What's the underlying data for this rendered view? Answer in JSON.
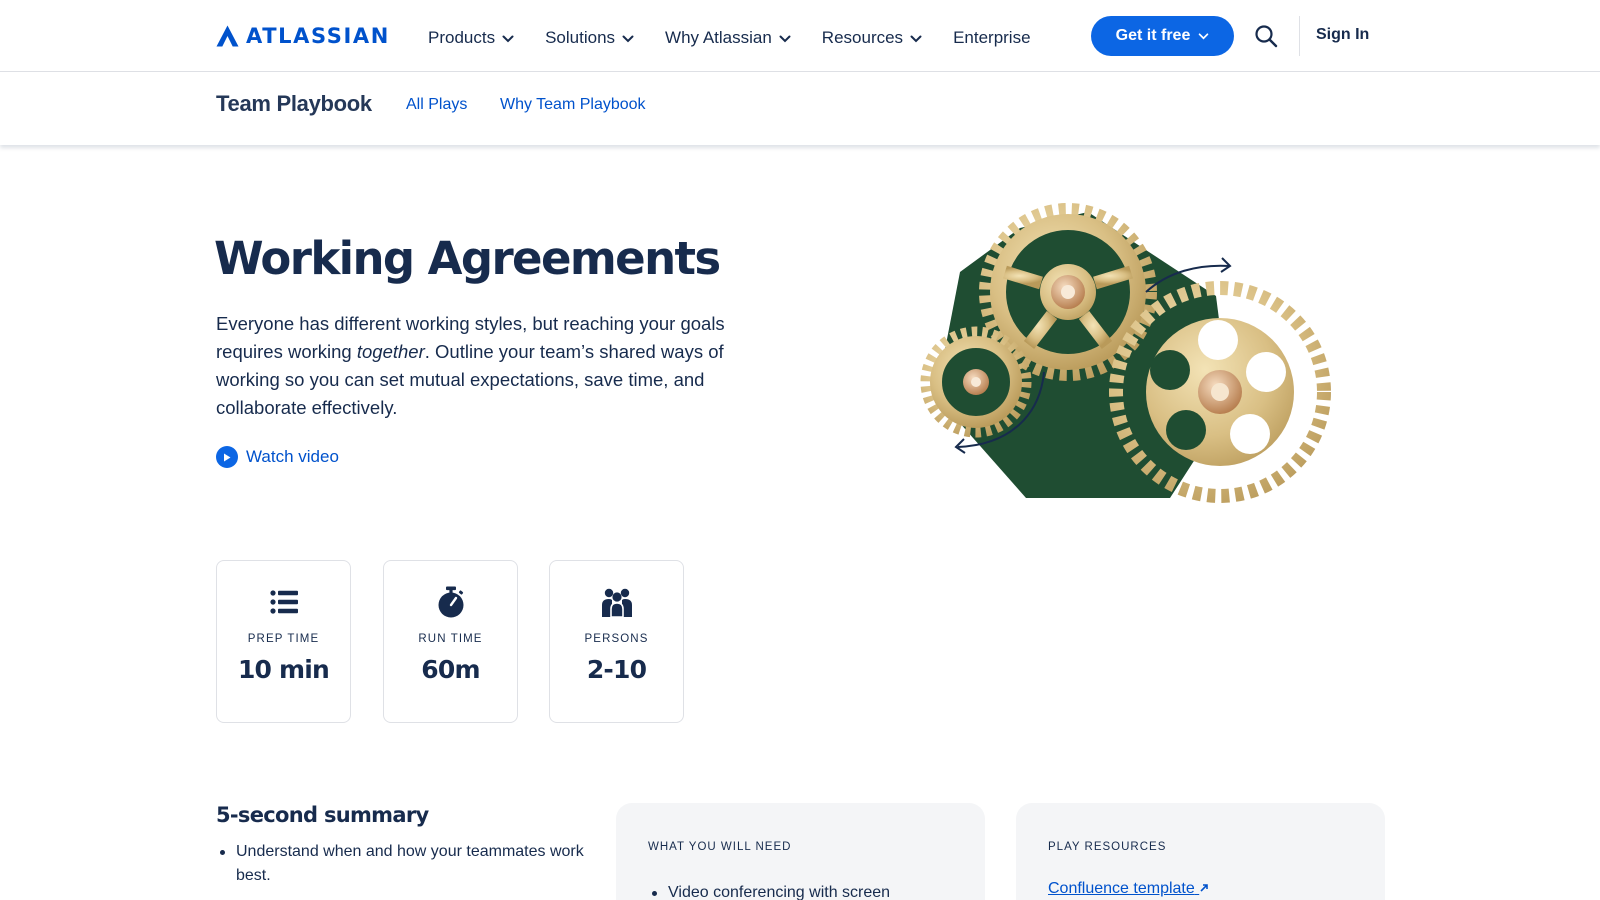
{
  "brand": {
    "name": "ATLASSIAN",
    "color": "#0052cc",
    "logo_icon": "atlassian-triangle-icon"
  },
  "topnav": {
    "items": [
      {
        "label": "Products",
        "dropdown": true
      },
      {
        "label": "Solutions",
        "dropdown": true
      },
      {
        "label": "Why Atlassian",
        "dropdown": true
      },
      {
        "label": "Resources",
        "dropdown": true
      },
      {
        "label": "Enterprise",
        "dropdown": false
      }
    ],
    "cta_label": "Get it free",
    "cta_color": "#0c66e4",
    "search_icon": "search-icon",
    "signin_label": "Sign In"
  },
  "subnav": {
    "title": "Team Playbook",
    "links": [
      "All Plays",
      "Why Team Playbook"
    ]
  },
  "hero": {
    "title": "Working Agreements",
    "desc_before": "Everyone has different working styles, but reaching your goals requires working ",
    "desc_emphasis": "together",
    "desc_after": ". Outline your team’s shared ways of working so you can set mutual expectations, save time, and collaborate effectively.",
    "watch_label": "Watch video",
    "illustration": "gears-illustration",
    "illustration_bg": "#1f4d32"
  },
  "stats": [
    {
      "icon": "list-icon",
      "label": "PREP TIME",
      "value": "10 min"
    },
    {
      "icon": "stopwatch-icon",
      "label": "RUN TIME",
      "value": "60m"
    },
    {
      "icon": "people-icon",
      "label": "PERSONS",
      "value": "2-10"
    }
  ],
  "summary": {
    "title": "5-second summary",
    "items": [
      "Understand when and how your teammates work best."
    ]
  },
  "needs": {
    "label": "WHAT YOU WILL NEED",
    "items": [
      "Video conferencing with screen"
    ]
  },
  "resources": {
    "label": "PLAY RESOURCES",
    "link_label": "Confluence template",
    "link_icon": "external-link-icon"
  }
}
